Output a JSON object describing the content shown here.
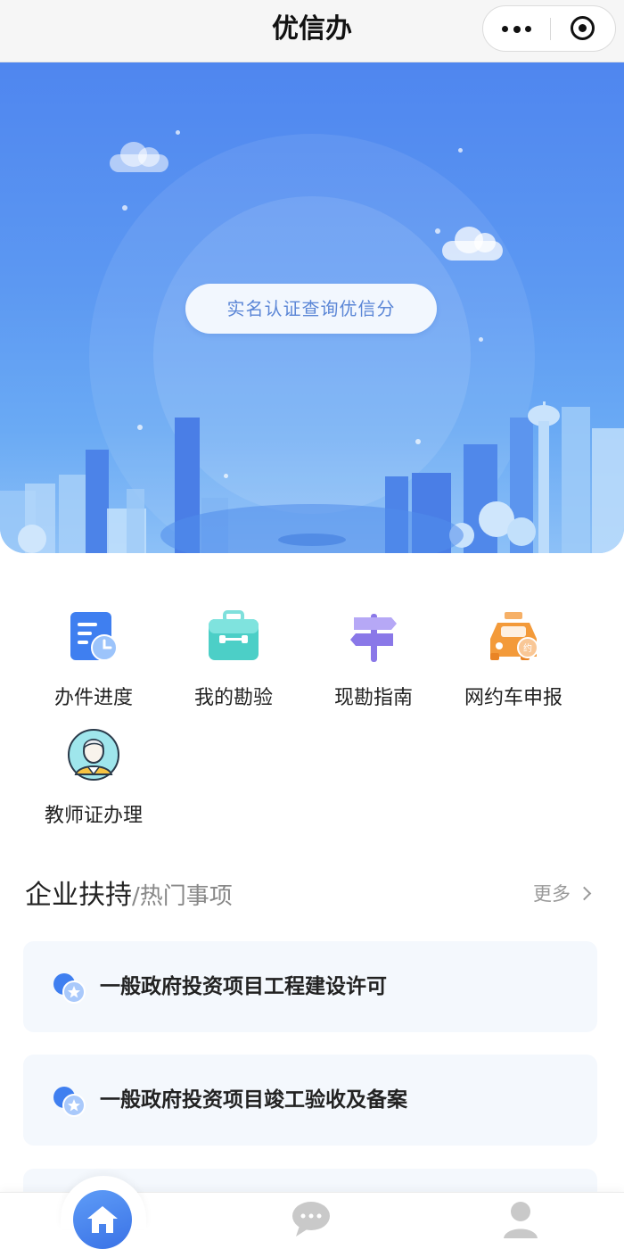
{
  "app": {
    "title": "优信办"
  },
  "capsule": {
    "menu_icon": "more-dots-icon",
    "close_icon": "target-close-icon"
  },
  "hero": {
    "verify_button_label": "实名认证查询优信分",
    "background_color": "#5b93f1"
  },
  "services": [
    {
      "label": "办件进度",
      "icon": "progress-document-clock-icon"
    },
    {
      "label": "我的勘验",
      "icon": "toolbox-icon"
    },
    {
      "label": "现勘指南",
      "icon": "signpost-icon"
    },
    {
      "label": "网约车申报",
      "icon": "ride-hailing-car-icon"
    },
    {
      "label": "教师证办理",
      "icon": "teacher-avatar-icon"
    }
  ],
  "section": {
    "title": "企业扶持",
    "subtitle": "/热门事项",
    "more_label": "更多"
  },
  "items": [
    {
      "label": "一般政府投资项目工程建设许可",
      "icon": "badge-star-icon"
    },
    {
      "label": "一般政府投资项目竣工验收及备案",
      "icon": "badge-star-icon"
    }
  ],
  "tabbar": [
    {
      "name": "home",
      "icon": "home-icon",
      "active": true
    },
    {
      "name": "messages",
      "icon": "chat-bubble-icon",
      "active": false
    },
    {
      "name": "profile",
      "icon": "user-icon",
      "active": false
    }
  ],
  "colors": {
    "accent": "#3d7af0",
    "card_background": "#f4f8fd",
    "muted_text": "#999999"
  }
}
